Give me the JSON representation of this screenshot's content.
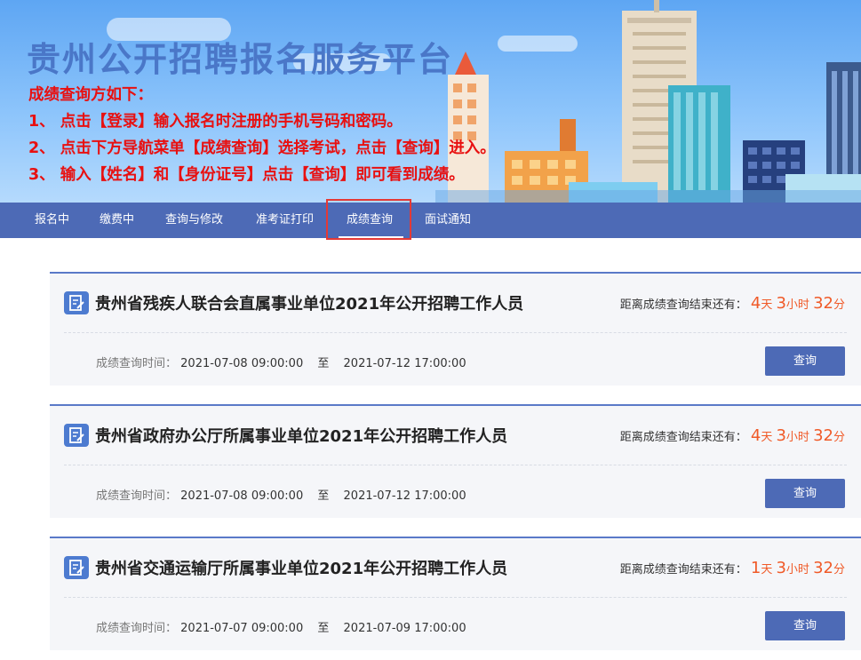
{
  "banner": {
    "site_title": "贵州公开招聘报名服务平台",
    "notice_heading": "成绩查询方如下：",
    "notice_lines": [
      "1、 点击【登录】输入报名时注册的手机号码和密码。",
      "2、 点击下方导航菜单【成绩查询】选择考试，点击【查询】进入。",
      "3、 输入【姓名】和【身份证号】点击【查询】即可看到成绩。"
    ]
  },
  "nav": {
    "items": [
      "报名中",
      "缴费中",
      "查询与修改",
      "准考证打印",
      "成绩查询",
      "面试通知"
    ],
    "active": "成绩查询"
  },
  "cards": [
    {
      "title": "贵州省残疾人联合会直属事业单位2021年公开招聘工作人员",
      "countdown_label": "距离成绩查询结束还有：",
      "days": "4",
      "days_unit": "天",
      "hours": "3",
      "hours_unit": "小时",
      "minutes": "32",
      "minutes_unit": "分",
      "time_label": "成绩查询时间：",
      "start": "2021-07-08 09:00:00",
      "to": "至",
      "end": "2021-07-12 17:00:00",
      "button": "查询"
    },
    {
      "title": "贵州省政府办公厅所属事业单位2021年公开招聘工作人员",
      "countdown_label": "距离成绩查询结束还有：",
      "days": "4",
      "days_unit": "天",
      "hours": "3",
      "hours_unit": "小时",
      "minutes": "32",
      "minutes_unit": "分",
      "time_label": "成绩查询时间：",
      "start": "2021-07-08 09:00:00",
      "to": "至",
      "end": "2021-07-12 17:00:00",
      "button": "查询"
    },
    {
      "title": "贵州省交通运输厅所属事业单位2021年公开招聘工作人员",
      "countdown_label": "距离成绩查询结束还有：",
      "days": "1",
      "days_unit": "天",
      "hours": "3",
      "hours_unit": "小时",
      "minutes": "32",
      "minutes_unit": "分",
      "time_label": "成绩查询时间：",
      "start": "2021-07-07 09:00:00",
      "to": "至",
      "end": "2021-07-09 17:00:00",
      "button": "查询"
    }
  ],
  "colors": {
    "nav_bg": "#4d6ab6",
    "title_blue": "#4a77c8",
    "notice_red": "#e81010",
    "countdown_orange": "#f05a28",
    "card_bg": "#f5f6f9",
    "highlight_box": "#e53935"
  },
  "icons": {
    "card_icon": "edit-document-icon"
  }
}
